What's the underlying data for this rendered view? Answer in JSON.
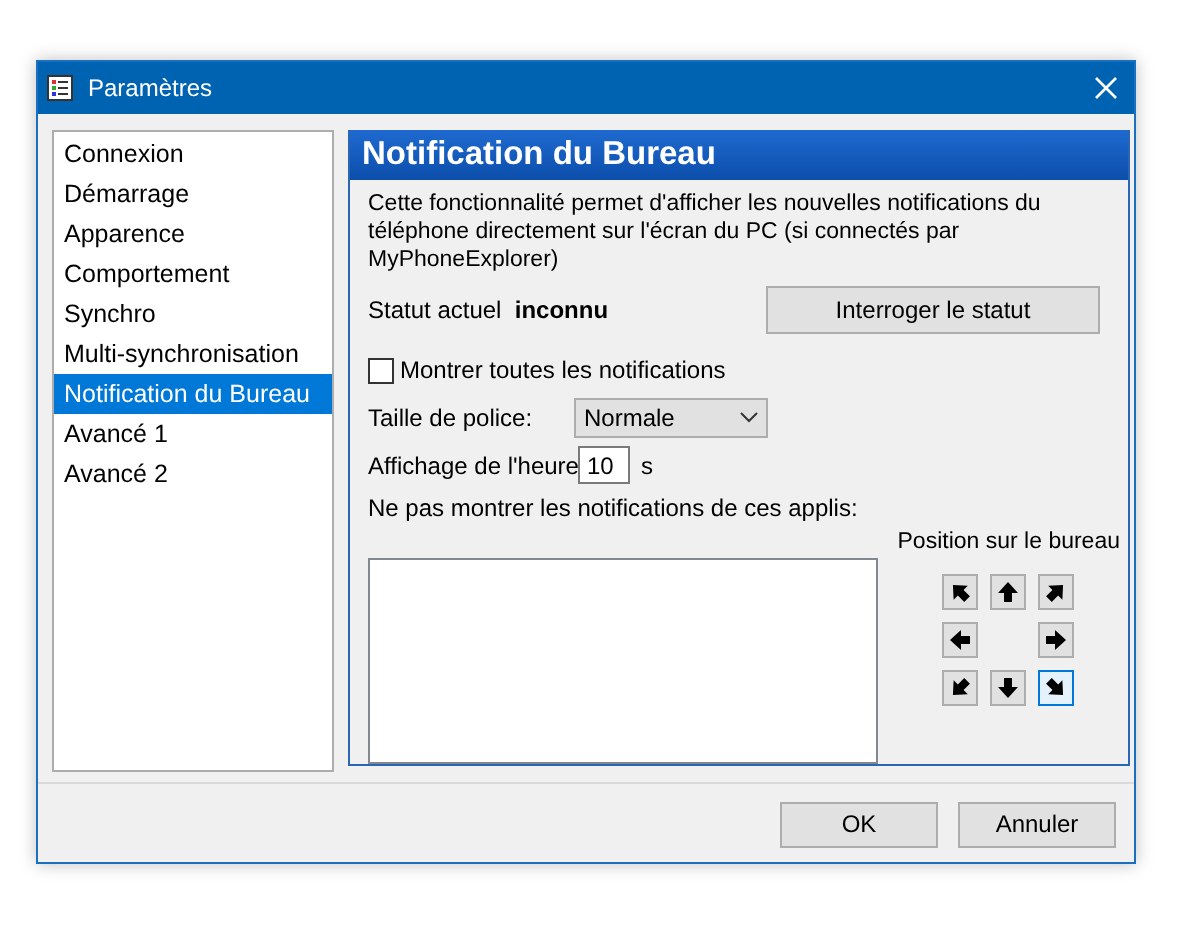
{
  "window": {
    "title": "Paramètres"
  },
  "sidebar": {
    "items": [
      {
        "label": "Connexion",
        "selected": false
      },
      {
        "label": "Démarrage",
        "selected": false
      },
      {
        "label": "Apparence",
        "selected": false
      },
      {
        "label": "Comportement",
        "selected": false
      },
      {
        "label": "Synchro",
        "selected": false
      },
      {
        "label": "Multi-synchronisation",
        "selected": false
      },
      {
        "label": "Notification du Bureau",
        "selected": true
      },
      {
        "label": "Avancé 1",
        "selected": false
      },
      {
        "label": "Avancé 2",
        "selected": false
      }
    ]
  },
  "panel": {
    "title": "Notification du Bureau",
    "description": "Cette fonctionnalité permet d'afficher les nouvelles notifications du téléphone directement sur l'écran du PC (si connectés par MyPhoneExplorer)",
    "status": {
      "label": "Statut actuel",
      "value": "inconnu"
    },
    "query_button": "Interroger le statut",
    "show_all": {
      "label": "Montrer toutes les notifications",
      "checked": false
    },
    "font_size": {
      "label": "Taille de police:",
      "value": "Normale"
    },
    "time_display": {
      "label": "Affichage de l'heure",
      "value": "10",
      "unit": "s"
    },
    "excluded_apps": {
      "label": "Ne pas montrer les notifications de ces applis:"
    },
    "position": {
      "label": "Position sur le bureau",
      "buttons": [
        {
          "kind": "nw",
          "selected": false
        },
        {
          "kind": "n",
          "selected": false
        },
        {
          "kind": "ne",
          "selected": false
        },
        {
          "kind": "w",
          "selected": false
        },
        {
          "kind": "e",
          "selected": false
        },
        {
          "kind": "sw",
          "selected": false
        },
        {
          "kind": "s",
          "selected": false
        },
        {
          "kind": "se",
          "selected": true
        }
      ]
    }
  },
  "buttons": [
    "OK",
    "Annuler"
  ]
}
